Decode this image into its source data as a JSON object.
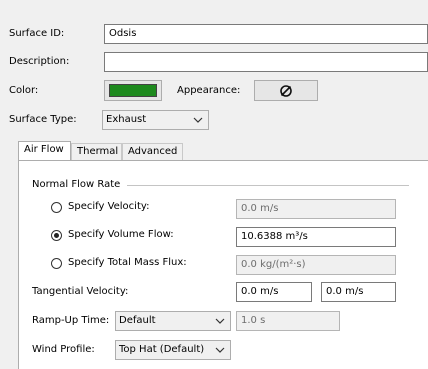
{
  "surface": {
    "id_label": "Surface ID:",
    "id_value": "Odsis",
    "description_label": "Description:",
    "description_value": "",
    "color_label": "Color:",
    "color_swatch": "#1e8a1e",
    "appearance_label": "Appearance:",
    "appearance_icon": "null-symbol-icon",
    "type_label": "Surface Type:",
    "type_value": "Exhaust"
  },
  "tabs": [
    {
      "label": "Air Flow",
      "active": true
    },
    {
      "label": "Thermal",
      "active": false
    },
    {
      "label": "Advanced",
      "active": false
    }
  ],
  "airflow": {
    "group_label": "Normal Flow Rate",
    "velocity_label": "Specify Velocity:",
    "velocity_value": "0.0 m/s",
    "volume_label": "Specify Volume Flow:",
    "volume_value": "10.6388 m³/s",
    "mass_label": "Specify Total Mass Flux:",
    "mass_value": "0.0 kg/(m²·s)",
    "selected": "volume",
    "tangential_label": "Tangential Velocity:",
    "tangential_x": "0.0 m/s",
    "tangential_y": "0.0 m/s",
    "ramp_label": "Ramp-Up Time:",
    "ramp_value": "Default",
    "ramp_time": "1.0 s",
    "wind_label": "Wind Profile:",
    "wind_value": "Top Hat (Default)"
  }
}
